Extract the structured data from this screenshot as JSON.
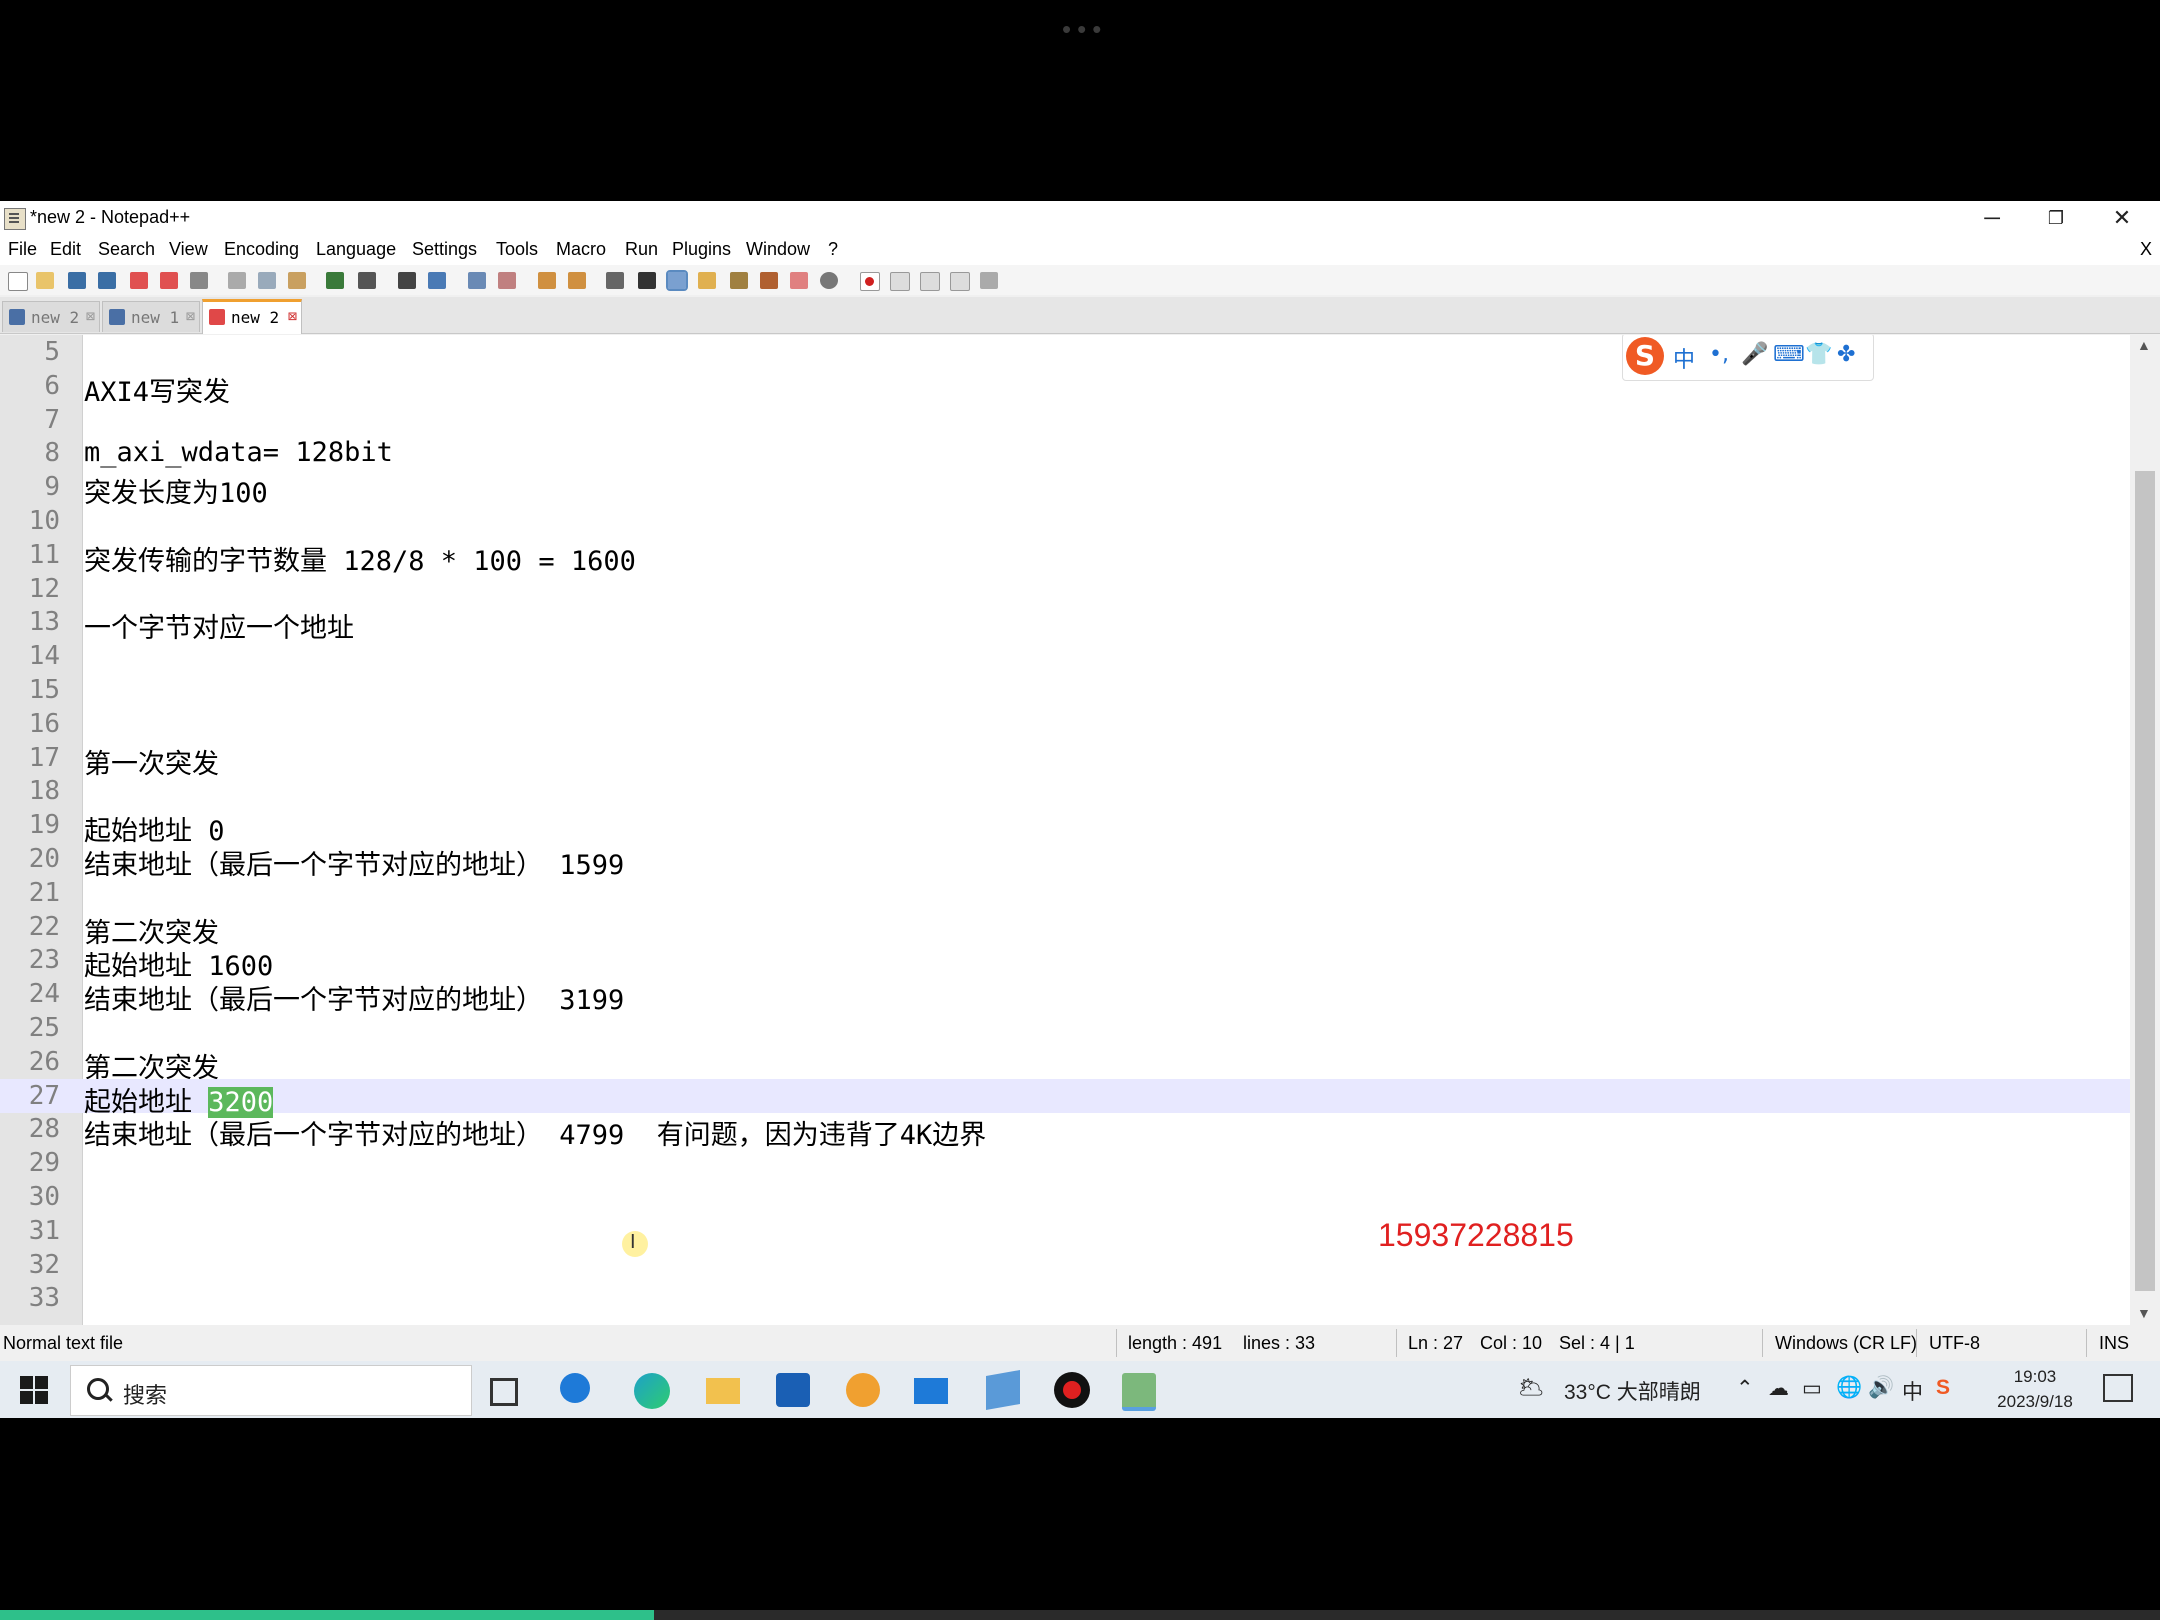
{
  "window": {
    "title": "*new 2 - Notepad++"
  },
  "menu": [
    "File",
    "Edit",
    "Search",
    "View",
    "Encoding",
    "Language",
    "Settings",
    "Tools",
    "Macro",
    "Run",
    "Plugins",
    "Window",
    "?"
  ],
  "menu_close": "X",
  "tabs": [
    {
      "label": "new 2",
      "close": "⊠",
      "active": false
    },
    {
      "label": "new 1",
      "close": "⊠",
      "active": false
    },
    {
      "label": "new 2",
      "close": "⊠",
      "active": true
    }
  ],
  "editor": {
    "lines": [
      {
        "num": "5",
        "text": ""
      },
      {
        "num": "6",
        "text": "AXI4写突发"
      },
      {
        "num": "7",
        "text": ""
      },
      {
        "num": "8",
        "text": "m_axi_wdata= 128bit"
      },
      {
        "num": "9",
        "text": "突发长度为100"
      },
      {
        "num": "10",
        "text": ""
      },
      {
        "num": "11",
        "text": "突发传输的字节数量 128/8 * 100 = 1600"
      },
      {
        "num": "12",
        "text": ""
      },
      {
        "num": "13",
        "text": "一个字节对应一个地址"
      },
      {
        "num": "14",
        "text": ""
      },
      {
        "num": "15",
        "text": ""
      },
      {
        "num": "16",
        "text": ""
      },
      {
        "num": "17",
        "text": "第一次突发"
      },
      {
        "num": "18",
        "text": ""
      },
      {
        "num": "19",
        "text": "起始地址 0"
      },
      {
        "num": "20",
        "text": "结束地址（最后一个字节对应的地址） 1599"
      },
      {
        "num": "21",
        "text": ""
      },
      {
        "num": "22",
        "text": "第二次突发"
      },
      {
        "num": "23",
        "text": "起始地址 1600"
      },
      {
        "num": "24",
        "text": "结束地址（最后一个字节对应的地址） 3199"
      },
      {
        "num": "25",
        "text": ""
      },
      {
        "num": "26",
        "text": "第二次突发"
      },
      {
        "num": "27",
        "text": "起始地址 ",
        "highlight": "3200",
        "current": true
      },
      {
        "num": "28",
        "text": "结束地址（最后一个字节对应的地址） 4799  有问题，因为违背了4K边界"
      },
      {
        "num": "29",
        "text": ""
      },
      {
        "num": "30",
        "text": ""
      },
      {
        "num": "31",
        "text": ""
      },
      {
        "num": "32",
        "text": ""
      },
      {
        "num": "33",
        "text": ""
      }
    ],
    "overlay_number": "15937228815"
  },
  "ime": {
    "logo": "S",
    "mode": "中",
    "punct": "•,"
  },
  "status": {
    "file_type": "Normal text file",
    "length": "length : 491",
    "lines": "lines : 33",
    "ln": "Ln : 27",
    "col": "Col : 10",
    "sel": "Sel : 4 | 1",
    "eol": "Windows (CR LF)",
    "encoding": "UTF-8",
    "mode": "INS"
  },
  "taskbar": {
    "search_placeholder": "搜索",
    "weather": "33°C 大部晴朗",
    "time": "19:03",
    "date": "2023/9/18"
  },
  "video_progress": 0.303,
  "colors": {
    "highlight_bg": "#5cb85c",
    "current_line": "#e8e8ff",
    "overlay_text": "#e02020"
  }
}
